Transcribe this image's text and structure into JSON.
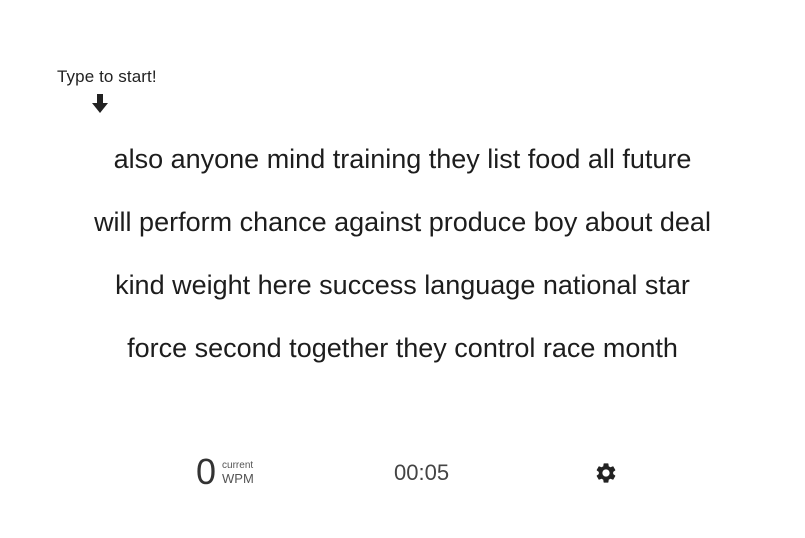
{
  "prompt": {
    "text": "Type to start!",
    "arrow_icon": "arrow-down-icon"
  },
  "words": {
    "lines": [
      "also anyone mind training they list food all future",
      "will perform chance against produce boy about deal",
      "kind weight here success language national star",
      "force second together they control race month"
    ]
  },
  "stats": {
    "wpm_value": "0",
    "wpm_sub": "current",
    "wpm_unit": "WPM",
    "timer": "00:05"
  },
  "controls": {
    "settings_icon": "gear-icon"
  }
}
